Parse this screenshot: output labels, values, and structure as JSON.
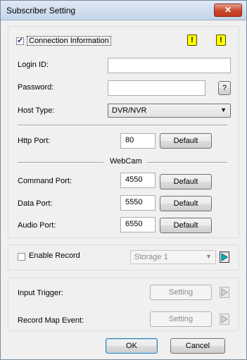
{
  "window": {
    "title": "Subscriber Setting",
    "close_glyph": "✕"
  },
  "connection": {
    "checkbox_label": "Connection Information",
    "checked": true,
    "warning_glyph": "!",
    "login_id_label": "Login ID:",
    "login_id_value": "",
    "password_label": "Password:",
    "password_value": "",
    "password_help_label": "?",
    "host_type_label": "Host Type:",
    "host_type_value": "DVR/NVR",
    "http_port_label": "Http Port:",
    "http_port_value": "80",
    "default_label": "Default",
    "webcam_heading": "WebCam",
    "command_port_label": "Command Port:",
    "command_port_value": "4550",
    "data_port_label": "Data Port:",
    "data_port_value": "5550",
    "audio_port_label": "Audio Port:",
    "audio_port_value": "6550"
  },
  "record": {
    "enable_label": "Enable Record",
    "enabled": false,
    "storage_value": "Storage 1"
  },
  "triggers": {
    "input_trigger_label": "Input Trigger:",
    "record_map_label": "Record Map Event:",
    "setting_label": "Setting"
  },
  "footer": {
    "ok_label": "OK",
    "cancel_label": "Cancel"
  }
}
